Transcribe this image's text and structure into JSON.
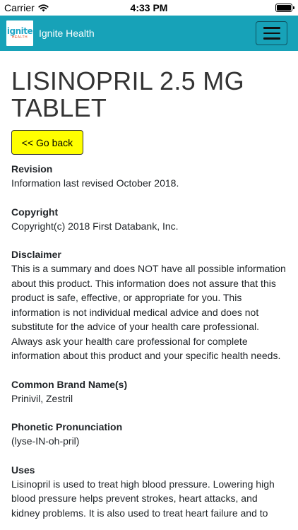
{
  "status_bar": {
    "carrier": "Carrier",
    "time": "4:33 PM"
  },
  "navbar": {
    "logo_text": "ignite",
    "logo_sub": "HEALTH",
    "brand_name": "Ignite Health"
  },
  "page": {
    "title": "LISINOPRIL 2.5 MG TABLET",
    "back_label": "<< Go back"
  },
  "sections": [
    {
      "heading": "Revision",
      "body": "Information last revised October 2018."
    },
    {
      "heading": "Copyright",
      "body": "Copyright(c) 2018 First Databank, Inc."
    },
    {
      "heading": "Disclaimer",
      "body": "This is a summary and does NOT have all possible information about this product.  This information does not assure that this product is safe, effective, or appropriate for you.  This information is not individual medical advice and does not substitute for the advice of your health care professional.  Always ask your health care professional for complete information about this product and your specific health needs."
    },
    {
      "heading": "Common Brand Name(s)",
      "body": "Prinivil, Zestril"
    },
    {
      "heading": "Phonetic Pronunciation",
      "body": "(lyse-IN-oh-pril)"
    },
    {
      "heading": "Uses",
      "body": "Lisinopril is used to treat high blood pressure.  Lowering high blood pressure helps prevent strokes, heart attacks, and kidney problems.  It is also used to treat heart failure and to"
    }
  ],
  "colors": {
    "navbar": "#17a2b8",
    "back_button": "#ffff00"
  },
  "icons": [
    "wifi-icon",
    "battery-icon",
    "hamburger-menu-icon"
  ]
}
